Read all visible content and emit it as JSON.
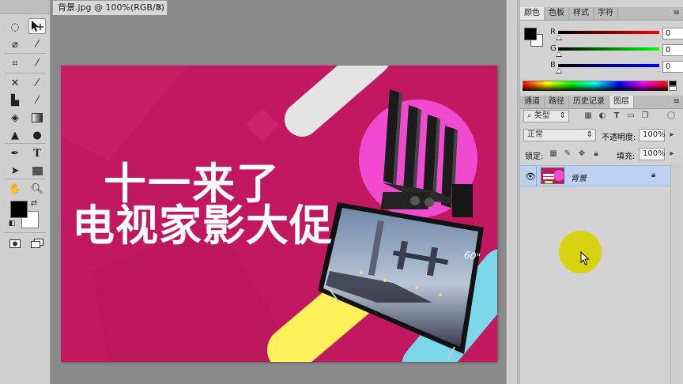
{
  "document": {
    "tab_title": "背景.jpg @ 100%(RGB/8) *",
    "close_glyph": "×"
  },
  "artwork": {
    "headline_line1": "十一来了",
    "headline_line2": "电视家影大促",
    "tv_size_label": "60\""
  },
  "color_panel": {
    "tabs": [
      "颜色",
      "色板",
      "样式",
      "字符"
    ],
    "channels": [
      {
        "label": "R",
        "value": "0"
      },
      {
        "label": "G",
        "value": "0"
      },
      {
        "label": "B",
        "value": "0"
      }
    ],
    "foreground": "#000000",
    "background": "#ffffff"
  },
  "layers_panel": {
    "tabs": [
      "通道",
      "路径",
      "历史记录",
      "图层"
    ],
    "filter_kind": "类型",
    "blend_mode": "正常",
    "opacity_label": "不透明度:",
    "opacity_value": "100%",
    "lock_label": "锁定:",
    "fill_label": "填充:",
    "fill_value": "100%",
    "layers": [
      {
        "name": "背景",
        "visible": true,
        "locked": true
      }
    ]
  },
  "colors": {
    "canvas_magenta": "#c2185f",
    "pink_circle": "#f04ad0",
    "yellow_stripe": "#fff15a",
    "cyan_stripe": "#7ad6e8",
    "gray_stripe": "#e4e4e4",
    "layer_selected": "#bcd0ef",
    "cursor_highlight": "#d7d000"
  },
  "icons": {
    "tools": [
      "marquee-icon",
      "move-icon",
      "lasso-icon",
      "magic-wand-icon",
      "crop-icon",
      "eyedropper-icon",
      "healing-icon",
      "brush-icon",
      "stamp-icon",
      "history-brush-icon",
      "eraser-icon",
      "gradient-icon",
      "blur-icon",
      "dodge-icon",
      "pen-icon",
      "type-icon",
      "path-select-icon",
      "rectangle-icon",
      "hand-icon",
      "zoom-icon"
    ]
  }
}
